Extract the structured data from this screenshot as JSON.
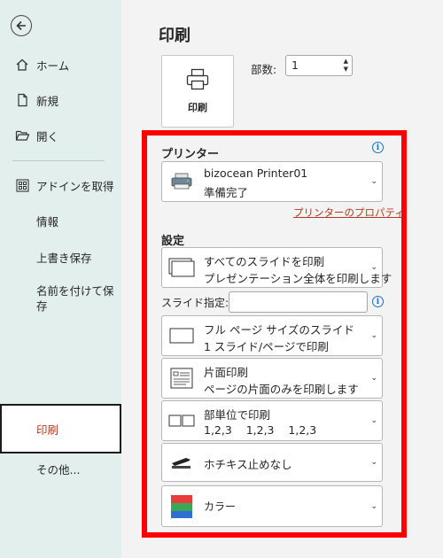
{
  "sidebar": {
    "items": [
      {
        "label": "ホーム",
        "icon": "home-icon"
      },
      {
        "label": "新規",
        "icon": "new-document-icon"
      },
      {
        "label": "開く",
        "icon": "folder-open-icon"
      },
      {
        "label": "アドインを取得",
        "icon": "addins-grid-icon"
      },
      {
        "label": "情報"
      },
      {
        "label": "上書き保存"
      },
      {
        "label": "名前を付けて保存"
      },
      {
        "label": "印刷",
        "selected": true
      },
      {
        "label": "その他..."
      }
    ]
  },
  "main": {
    "title": "印刷",
    "print_button": {
      "label": "印刷"
    },
    "copies": {
      "label": "部数:",
      "value": "1"
    },
    "printer": {
      "section_title": "プリンター",
      "name": "bizocean Printer01",
      "status": "準備完了",
      "properties_link": "プリンターのプロパティ"
    },
    "settings": {
      "section_title": "設定",
      "slides_option": {
        "title": "すべてのスライドを印刷",
        "subtitle": "プレゼンテーション全体を印刷します"
      },
      "slide_spec_label": "スライド指定:",
      "slide_spec_value": "",
      "layout_option": {
        "title": "フル ページ サイズのスライド",
        "subtitle": "1 スライド/ページで印刷"
      },
      "sides_option": {
        "title": "片面印刷",
        "subtitle": "ページの片面のみを印刷します"
      },
      "collate_option": {
        "title": "部単位で印刷",
        "subtitle": "1,2,3    1,2,3    1,2,3"
      },
      "staple_option": {
        "title": "ホチキス止めなし"
      },
      "color_option": {
        "title": "カラー"
      }
    }
  },
  "colors": {
    "highlight": "#ff0000",
    "accent": "#b23a20",
    "info": "#1f6fc5"
  }
}
